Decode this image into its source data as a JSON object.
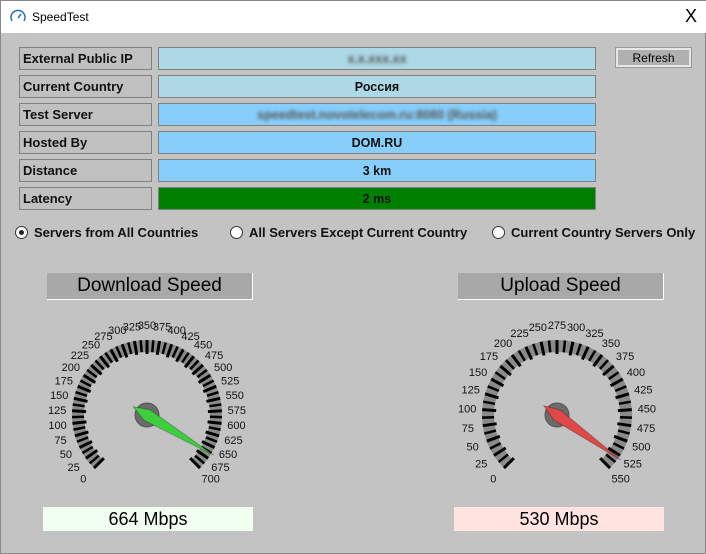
{
  "window": {
    "title": "SpeedTest",
    "close_label": "X"
  },
  "info": {
    "rows": [
      {
        "label": "External Public IP",
        "value": "x.x.xxx.xx",
        "blurred": true,
        "color": "#add8e6"
      },
      {
        "label": "Current Country",
        "value": "Россия",
        "color": "#add8e6"
      },
      {
        "label": "Test Server",
        "value": "speedtest.novotelecom.ru:8080 (Russia)",
        "blurred": true,
        "color": "#87cefa"
      },
      {
        "label": "Hosted By",
        "value": "DOM.RU",
        "color": "#87cefa"
      },
      {
        "label": "Distance",
        "value": "3 km",
        "color": "#87cefa"
      },
      {
        "label": "Latency",
        "value": "2 ms",
        "color": "#008000"
      }
    ],
    "refresh_label": "Refresh"
  },
  "radios": [
    {
      "label": "Servers from All Countries",
      "checked": true
    },
    {
      "label": "All Servers Except Current Country",
      "checked": false
    },
    {
      "label": "Current Country Servers Only",
      "checked": false
    }
  ],
  "download": {
    "title": "Download Speed",
    "value": 664,
    "max": 700,
    "step": 25,
    "result": "664 Mbps",
    "needle_color": "#3ecf3e",
    "result_bg": "#f0fff0"
  },
  "upload": {
    "title": "Upload Speed",
    "value": 530,
    "max": 550,
    "step": 25,
    "result": "530 Mbps",
    "needle_color": "#e04848",
    "result_bg": "#ffe4e1"
  }
}
